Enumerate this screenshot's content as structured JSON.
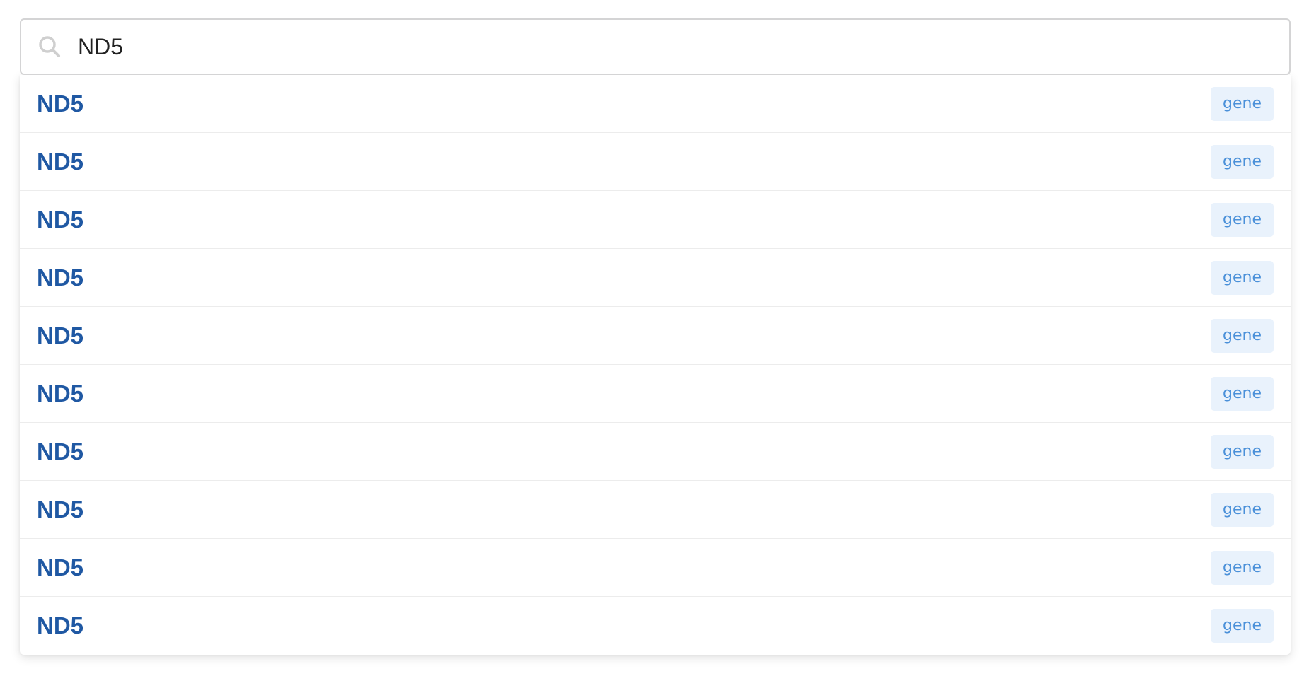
{
  "search": {
    "value": "ND5",
    "icon": "search-icon"
  },
  "colors": {
    "title": "#1f58a3",
    "badge_text": "#4a90d9",
    "badge_bg": "#e9f2fc"
  },
  "results": [
    {
      "title": "ND5",
      "type": "gene"
    },
    {
      "title": "ND5",
      "type": "gene"
    },
    {
      "title": "ND5",
      "type": "gene"
    },
    {
      "title": "ND5",
      "type": "gene"
    },
    {
      "title": "ND5",
      "type": "gene"
    },
    {
      "title": "ND5",
      "type": "gene"
    },
    {
      "title": "ND5",
      "type": "gene"
    },
    {
      "title": "ND5",
      "type": "gene"
    },
    {
      "title": "ND5",
      "type": "gene"
    },
    {
      "title": "ND5",
      "type": "gene"
    }
  ]
}
